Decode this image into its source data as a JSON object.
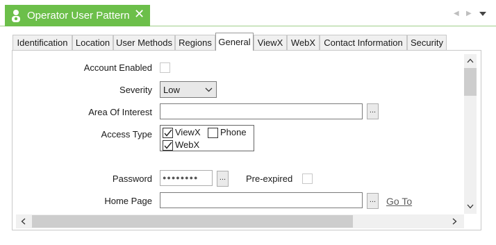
{
  "window": {
    "title": "Operator User Pattern"
  },
  "tabs": [
    "Identification",
    "Location",
    "User Methods",
    "Regions",
    "General",
    "ViewX",
    "WebX",
    "Contact Information",
    "Security"
  ],
  "active_tab": "General",
  "form": {
    "account_enabled_label": "Account Enabled",
    "severity_label": "Severity",
    "severity_value": "Low",
    "area_of_interest_label": "Area Of Interest",
    "area_of_interest_value": "",
    "browse_label": "...",
    "access_type_label": "Access Type",
    "access_options": {
      "viewx": "ViewX",
      "phone": "Phone",
      "webx": "WebX"
    },
    "password_label": "Password",
    "password_value": "●●●●●●●●",
    "pre_expired_label": "Pre-expired",
    "home_page_label": "Home Page",
    "home_page_value": "",
    "go_to_label": "Go To"
  },
  "colors": {
    "accent": "#6cbf4a"
  },
  "icons": [
    "person-icon",
    "close-icon",
    "nav-left-icon",
    "nav-right-icon",
    "dropdown-icon",
    "chevron-down-icon",
    "check-icon",
    "scroll-up-icon",
    "scroll-down-icon",
    "scroll-left-icon",
    "scroll-right-icon"
  ]
}
